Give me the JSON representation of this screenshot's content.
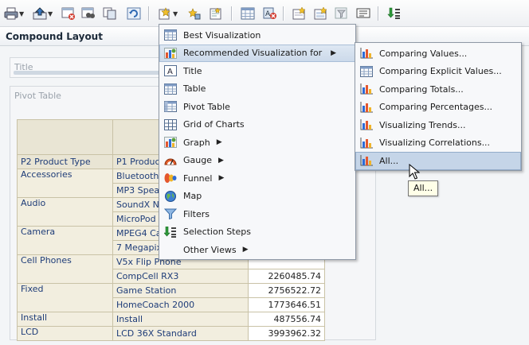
{
  "layout": {
    "title": "Compound Layout"
  },
  "views": {
    "title_label": "Title",
    "pivot_label": "Pivot Table"
  },
  "toolbar": {
    "icons": [
      "print-icon",
      "export-icon",
      "delete-view-icon",
      "show-view-icon",
      "copy-icon",
      "refresh-icon",
      "new-view-icon",
      "edit-view-icon",
      "edit-properties-icon",
      "table-icon",
      "remove-icon",
      "criteria-icon",
      "prompt-icon",
      "filter-icon",
      "narrative-icon",
      "selection-steps-icon"
    ]
  },
  "menu_main": {
    "items": [
      {
        "label": "Best Visualization",
        "icon": "table-icon"
      },
      {
        "label": "Recommended Visualization for",
        "icon": "chart-icon",
        "submenu": true,
        "highlighted": true
      },
      {
        "label": "Title",
        "icon": "title-icon"
      },
      {
        "label": "Table",
        "icon": "table-icon"
      },
      {
        "label": "Pivot Table",
        "icon": "pivot-icon"
      },
      {
        "label": "Grid of Charts",
        "icon": "grid-icon"
      },
      {
        "label": "Graph",
        "icon": "graph-icon",
        "submenu": true
      },
      {
        "label": "Gauge",
        "icon": "gauge-icon",
        "submenu": true
      },
      {
        "label": "Funnel",
        "icon": "funnel-icon",
        "submenu": true
      },
      {
        "label": "Map",
        "icon": "map-icon"
      },
      {
        "label": "Filters",
        "icon": "filter-icon"
      },
      {
        "label": "Selection Steps",
        "icon": "selection-steps-icon"
      },
      {
        "label": "Other Views",
        "icon": "",
        "submenu": true
      }
    ]
  },
  "menu_sub": {
    "items": [
      {
        "label": "Comparing Values..."
      },
      {
        "label": "Comparing Explicit Values...",
        "icon": "table-icon"
      },
      {
        "label": "Comparing Totals..."
      },
      {
        "label": "Comparing Percentages..."
      },
      {
        "label": "Visualizing Trends..."
      },
      {
        "label": "Visualizing Correlations..."
      },
      {
        "label": "All...",
        "highlighted": true
      }
    ]
  },
  "tooltip": {
    "text": "All..."
  },
  "pivot": {
    "headers": [
      "P2 Product Type",
      "P1 Produc"
    ],
    "rows": [
      {
        "type": "Accessories",
        "products": [
          {
            "name": "Bluetooth",
            "value": ""
          },
          {
            "name": "MP3 Speak",
            "value": ""
          }
        ]
      },
      {
        "type": "Audio",
        "products": [
          {
            "name": "SoundX N",
            "value": ""
          },
          {
            "name": "MicroPod",
            "value": ""
          }
        ]
      },
      {
        "type": "Camera",
        "products": [
          {
            "name": "MPEG4 Ca",
            "value": ""
          },
          {
            "name": "7 Megapix",
            "value": ""
          }
        ]
      },
      {
        "type": "Cell Phones",
        "products": [
          {
            "name": "V5x Flip Phone",
            "value": ""
          },
          {
            "name": "CompCell RX3",
            "value": "2260485.74"
          }
        ]
      },
      {
        "type": "Fixed",
        "products": [
          {
            "name": "Game Station",
            "value": "2756522.72"
          },
          {
            "name": "HomeCoach 2000",
            "value": "1773646.51"
          }
        ]
      },
      {
        "type": "Install",
        "products": [
          {
            "name": "Install",
            "value": "487556.74"
          }
        ]
      },
      {
        "type": "LCD",
        "products": [
          {
            "name": "LCD 36X Standard",
            "value": "3993962.32"
          }
        ]
      }
    ]
  },
  "colors": {
    "link": "#1e3c78",
    "menu_highlight": "#cbd9ea",
    "table_beige": "#f2eedf"
  }
}
